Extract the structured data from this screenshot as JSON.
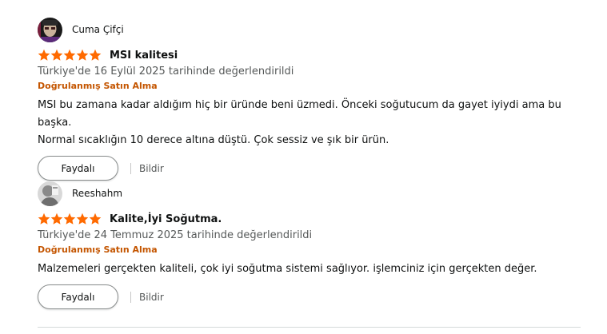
{
  "colors": {
    "star": "#ff6a00",
    "verified": "#c45500",
    "secondary_text": "#565959"
  },
  "reviews": [
    {
      "author": "Cuma Çifçi",
      "rating": 5,
      "title": "MSI kalitesi",
      "date": "Türkiye'de 16 Eylül 2025 tarihinde değerlendirildi",
      "verified": "Doğrulanmış Satın Alma",
      "body_line1": "MSI bu zamana kadar aldığım hiç bir üründe beni üzmedi. Önceki soğutucum da gayet iyiydi ama bu başka.",
      "body_line2": "Normal sıcaklığın 10 derece altına düştü. Çok sessiz ve şık bir ürün.",
      "helpful_label": "Faydalı",
      "report_label": "Bildir"
    },
    {
      "author": "Reeshahm",
      "rating": 5,
      "title": "Kalite,İyi Soğutma.",
      "date": "Türkiye'de 24 Temmuz 2025 tarihinde değerlendirildi",
      "verified": "Doğrulanmış Satın Alma",
      "body_line1": "Malzemeleri gerçekten kaliteli, çok iyi soğutma sistemi sağlıyor. işlemciniz için gerçekten değer.",
      "helpful_label": "Faydalı",
      "report_label": "Bildir"
    }
  ]
}
